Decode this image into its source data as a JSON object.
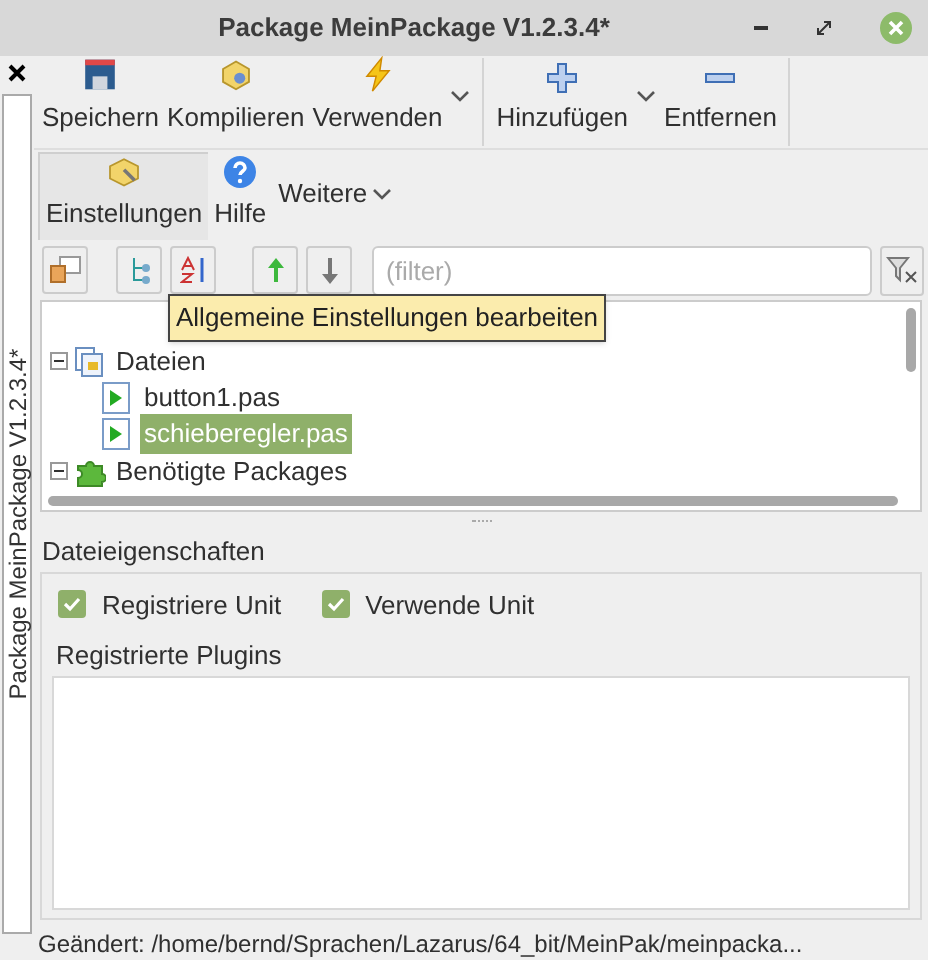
{
  "window": {
    "title": "Package MeinPackage V1.2.3.4*"
  },
  "side_tab": {
    "label": "Package MeinPackage V1.2.3.4*"
  },
  "toolbar": [
    {
      "label": "Speichern",
      "dropdown": false
    },
    {
      "label": "Kompilieren",
      "dropdown": false
    },
    {
      "label": "Verwenden",
      "dropdown": true
    },
    {
      "label": "Hinzufügen",
      "dropdown": true
    },
    {
      "label": "Entfernen",
      "dropdown": false
    }
  ],
  "toolbar2": [
    {
      "label": "Einstellungen",
      "selected": true
    },
    {
      "label": "Hilfe",
      "selected": false
    }
  ],
  "more_menu": {
    "label": "Weitere"
  },
  "filter": {
    "placeholder": "(filter)"
  },
  "tooltip": {
    "text": "Allgemeine Einstellungen bearbeiten"
  },
  "tree": [
    {
      "label": "Dateien",
      "kind": "folder",
      "expanded": true,
      "selected": false,
      "children": [
        {
          "label": "button1.pas",
          "kind": "unit",
          "selected": false
        },
        {
          "label": "schieberegler.pas",
          "kind": "unit",
          "selected": true
        }
      ]
    },
    {
      "label": "Benötigte Packages",
      "kind": "package",
      "expanded": true,
      "selected": false
    }
  ],
  "file_properties": {
    "title": "Dateieigenschaften",
    "options": [
      {
        "label": "Registriere Unit",
        "checked": true
      },
      {
        "label": "Verwende Unit",
        "checked": true
      }
    ],
    "plugins_title": "Registrierte Plugins"
  },
  "status_bar": {
    "text": "Geändert: /home/bernd/Sprachen/Lazarus/64_bit/MeinPak/meinpacka..."
  }
}
